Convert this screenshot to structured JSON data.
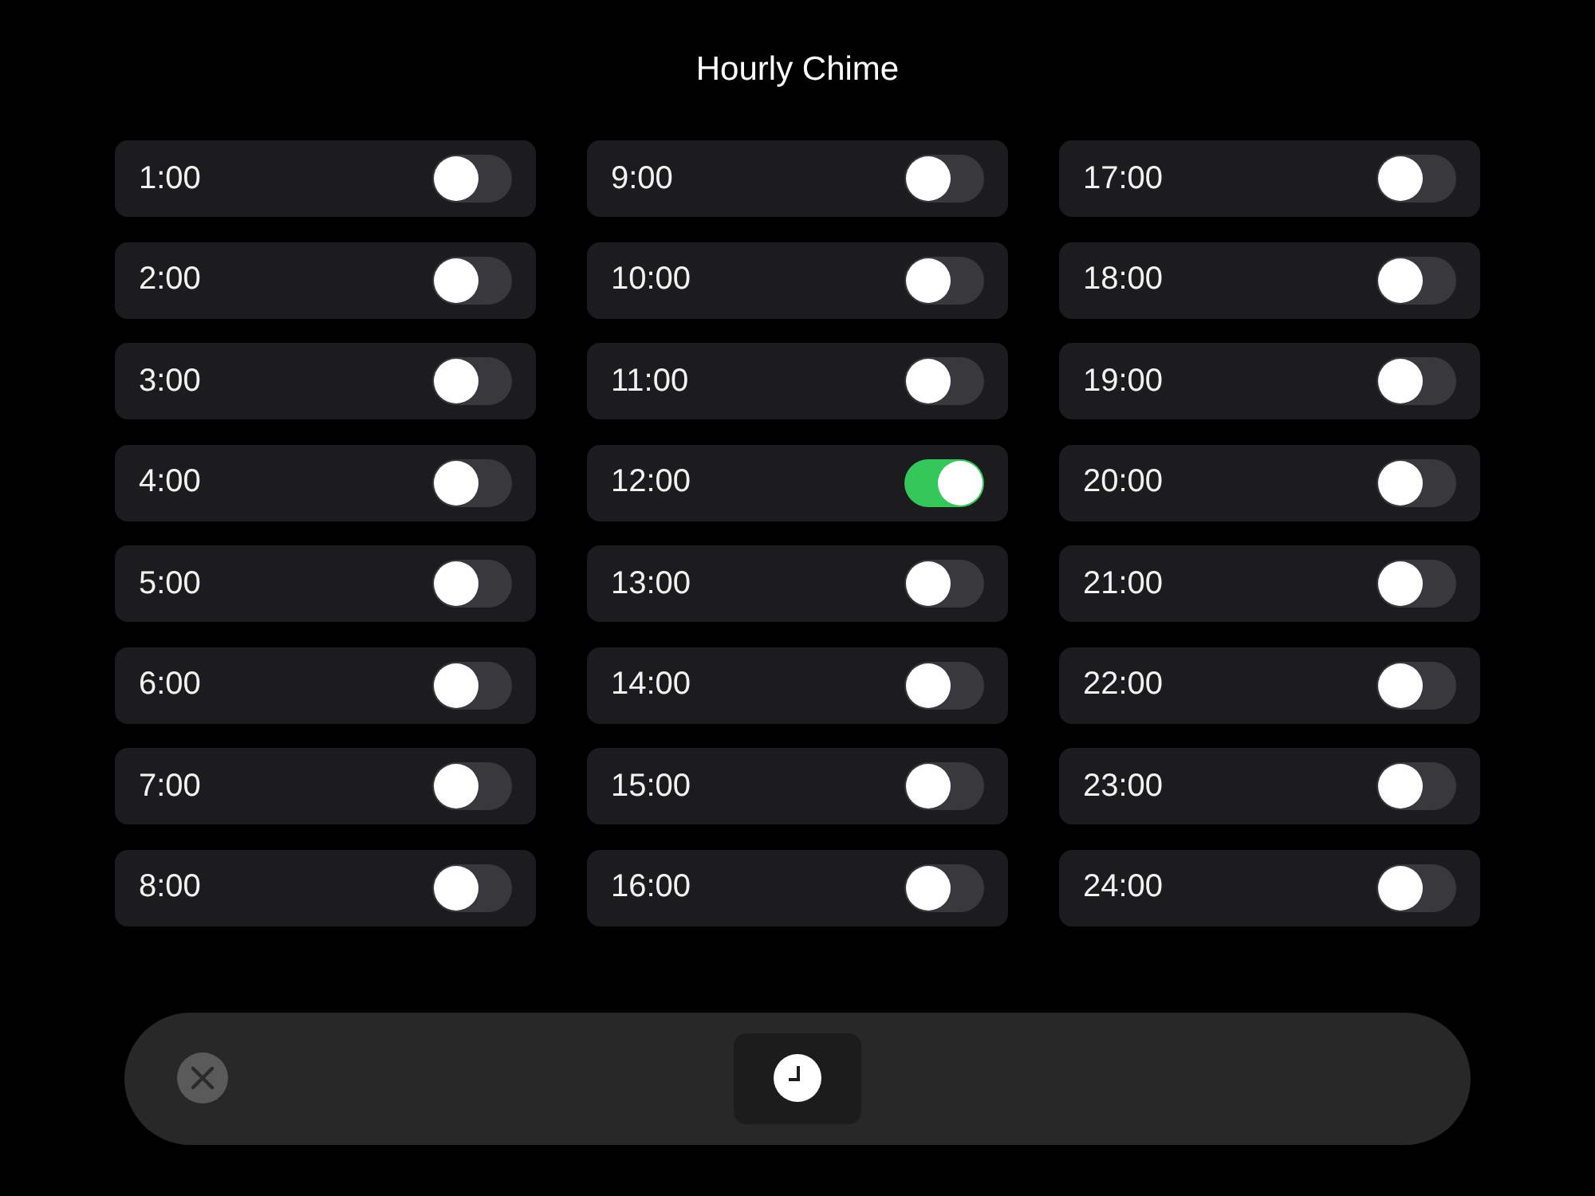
{
  "title": "Hourly Chime",
  "chimes": [
    {
      "label": "1:00",
      "on": false
    },
    {
      "label": "2:00",
      "on": false
    },
    {
      "label": "3:00",
      "on": false
    },
    {
      "label": "4:00",
      "on": false
    },
    {
      "label": "5:00",
      "on": false
    },
    {
      "label": "6:00",
      "on": false
    },
    {
      "label": "7:00",
      "on": false
    },
    {
      "label": "8:00",
      "on": false
    },
    {
      "label": "9:00",
      "on": false
    },
    {
      "label": "10:00",
      "on": false
    },
    {
      "label": "11:00",
      "on": false
    },
    {
      "label": "12:00",
      "on": true
    },
    {
      "label": "13:00",
      "on": false
    },
    {
      "label": "14:00",
      "on": false
    },
    {
      "label": "15:00",
      "on": false
    },
    {
      "label": "16:00",
      "on": false
    },
    {
      "label": "17:00",
      "on": false
    },
    {
      "label": "18:00",
      "on": false
    },
    {
      "label": "19:00",
      "on": false
    },
    {
      "label": "20:00",
      "on": false
    },
    {
      "label": "21:00",
      "on": false
    },
    {
      "label": "22:00",
      "on": false
    },
    {
      "label": "23:00",
      "on": false
    },
    {
      "label": "24:00",
      "on": false
    }
  ]
}
